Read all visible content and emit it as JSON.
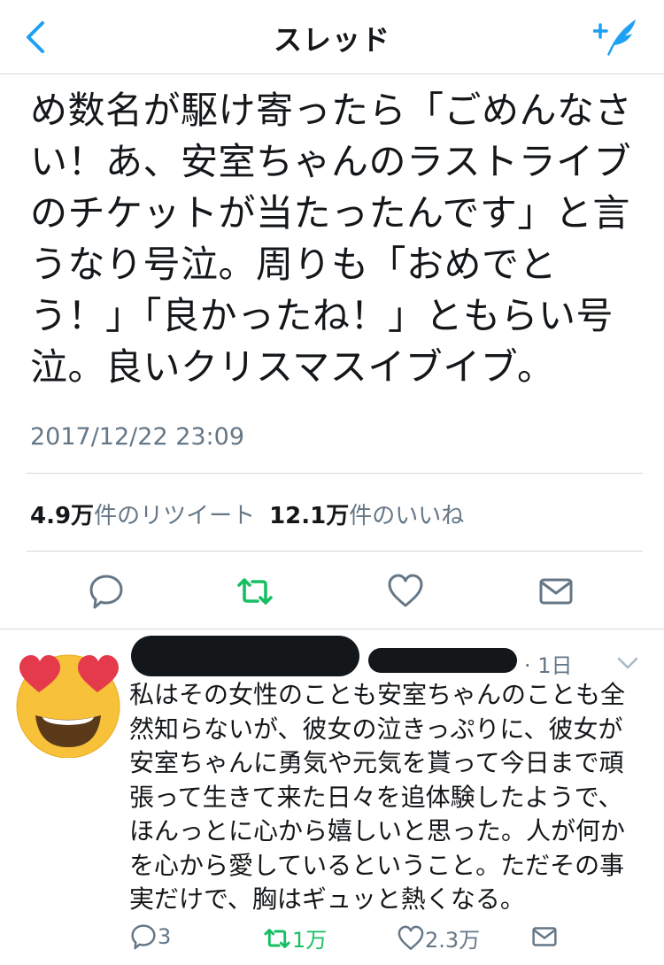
{
  "nav": {
    "title": "スレッド",
    "back_icon": "chevron-left-icon",
    "compose_icon": "compose-quill-icon",
    "accent": "#1da1f2"
  },
  "tweet": {
    "text": "め数名が駆け寄ったら「ごめんなさ\nい！あ、安室ちゃんのラストライブ\nのチケットが当たったんです」と言\nうなり号泣。周りも「おめでと\nう！」「良かったね！」ともらい号\n泣。良いクリスマスイブイブ。",
    "timestamp": "2017/12/22 23:09",
    "retweets_count": "4.9万",
    "retweets_label": "件のリツイート",
    "likes_count": "12.1万",
    "likes_label": "件のいいね",
    "retweet_color": "#17bf63"
  },
  "reply": {
    "time": "· 1日",
    "text": "私はその女性のことも安室ちゃんのことも全\n然知らないが、彼女の泣きっぷりに、彼女が\n安室ちゃんに勇気や元気を貰って今日まで頑\n張って生きて来た日々を追体験したようで、\nほんっとに心から嬉しいと思った。人が何か\nを心から愛しているということ。ただその事\n実だけで、胸はギュッと熱くなる。",
    "reply_count": "3",
    "retweet_count": "1万",
    "like_count": "2.3万",
    "avatar_icon": "heart-eyes-emoji-icon"
  }
}
